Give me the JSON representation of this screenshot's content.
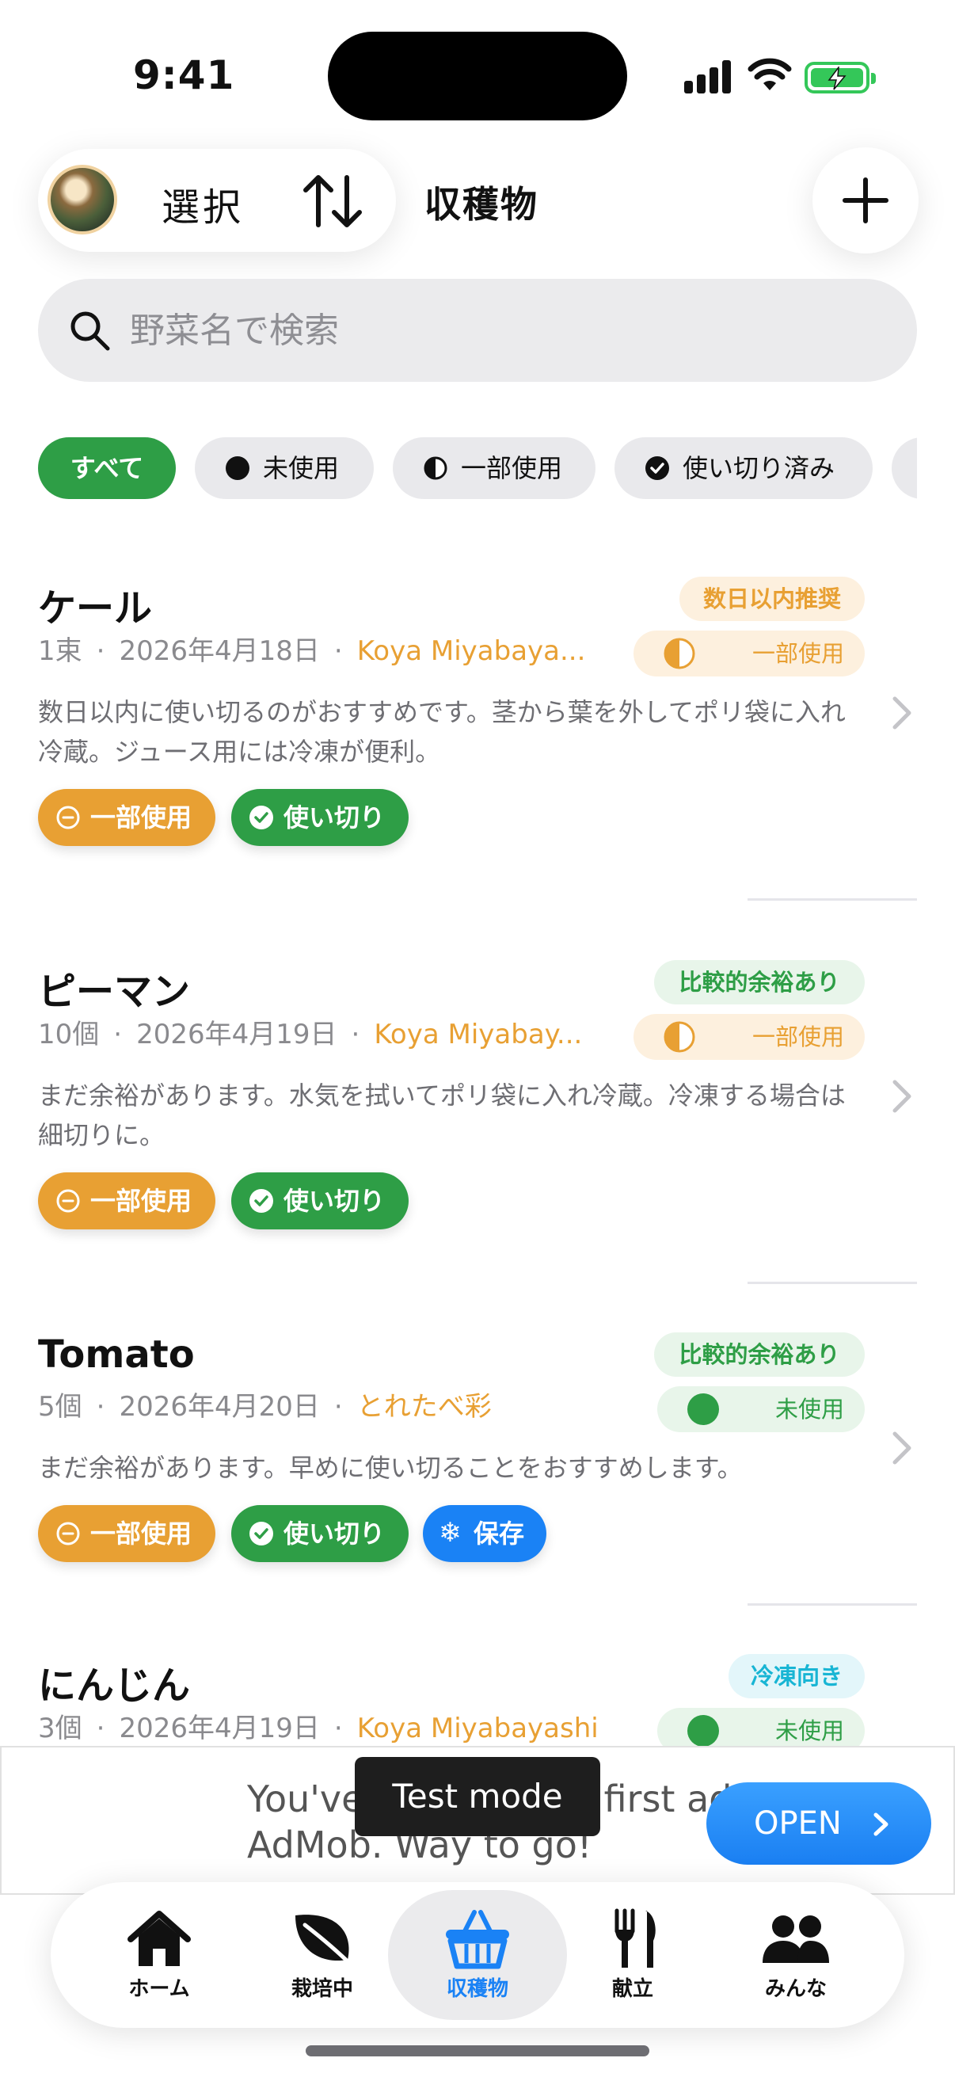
{
  "status_bar": {
    "time": "9:41"
  },
  "toolbar": {
    "select_label": "選択",
    "title": "収穫物"
  },
  "search": {
    "placeholder": "野菜名で検索",
    "value": ""
  },
  "filters": [
    {
      "label": "すべて",
      "selected": true,
      "icon": "none"
    },
    {
      "label": "未使用",
      "selected": false,
      "icon": "filled-circle-icon"
    },
    {
      "label": "一部使用",
      "selected": false,
      "icon": "half-circle-icon"
    },
    {
      "label": "使い切り済み",
      "selected": false,
      "icon": "check-circle-icon"
    }
  ],
  "items": [
    {
      "name": "ケール",
      "quantity": "1束",
      "date": "2026年4月18日",
      "grower": "Koya Miyabaya...",
      "advice": "数日以内推奨",
      "status": "一部使用",
      "description": "数日以内に使い切るのがおすすめです。茎から葉を外してポリ袋に入れ冷蔵。ジュース用には冷凍が便利。",
      "actions": [
        "一部使用",
        "使い切り"
      ]
    },
    {
      "name": "ピーマン",
      "quantity": "10個",
      "date": "2026年4月19日",
      "grower": "Koya Miyabay...",
      "advice": "比較的余裕あり",
      "status": "一部使用",
      "description": "まだ余裕があります。水気を拭いてポリ袋に入れ冷蔵。冷凍する場合は細切りに。",
      "actions": [
        "一部使用",
        "使い切り"
      ]
    },
    {
      "name": "Tomato",
      "quantity": "5個",
      "date": "2026年4月20日",
      "grower": "とれたべ彩",
      "advice": "比較的余裕あり",
      "status": "未使用",
      "description": "まだ余裕があります。早めに使い切ることをおすすめします。",
      "actions": [
        "一部使用",
        "使い切り",
        "保存"
      ]
    },
    {
      "name": "にんじん",
      "quantity": "3個",
      "date": "2026年4月19日",
      "grower": "Koya Miyabayashi",
      "advice": "冷凍向き",
      "status": "未使用"
    }
  ],
  "ad": {
    "text": "You've loaded your first ad from\nAdMob. Way to go!",
    "open_label": "OPEN",
    "test_mode_label": "Test mode"
  },
  "tabs": [
    {
      "label": "ホーム",
      "icon": "house-icon"
    },
    {
      "label": "栽培中",
      "icon": "leaf-icon"
    },
    {
      "label": "収穫物",
      "icon": "basket-icon",
      "active": true
    },
    {
      "label": "献立",
      "icon": "fork-knife-icon"
    },
    {
      "label": "みんな",
      "icon": "people-icon"
    }
  ],
  "colors": {
    "accent_green": "#2e9e46",
    "partial_orange": "#e8a033",
    "freeze_blue": "#1a82f5",
    "advice_soon_bg": "#fdf0de",
    "advice_relaxed_bg": "#e8f5ea",
    "advice_freeze_bg": "#e3f6fa"
  }
}
